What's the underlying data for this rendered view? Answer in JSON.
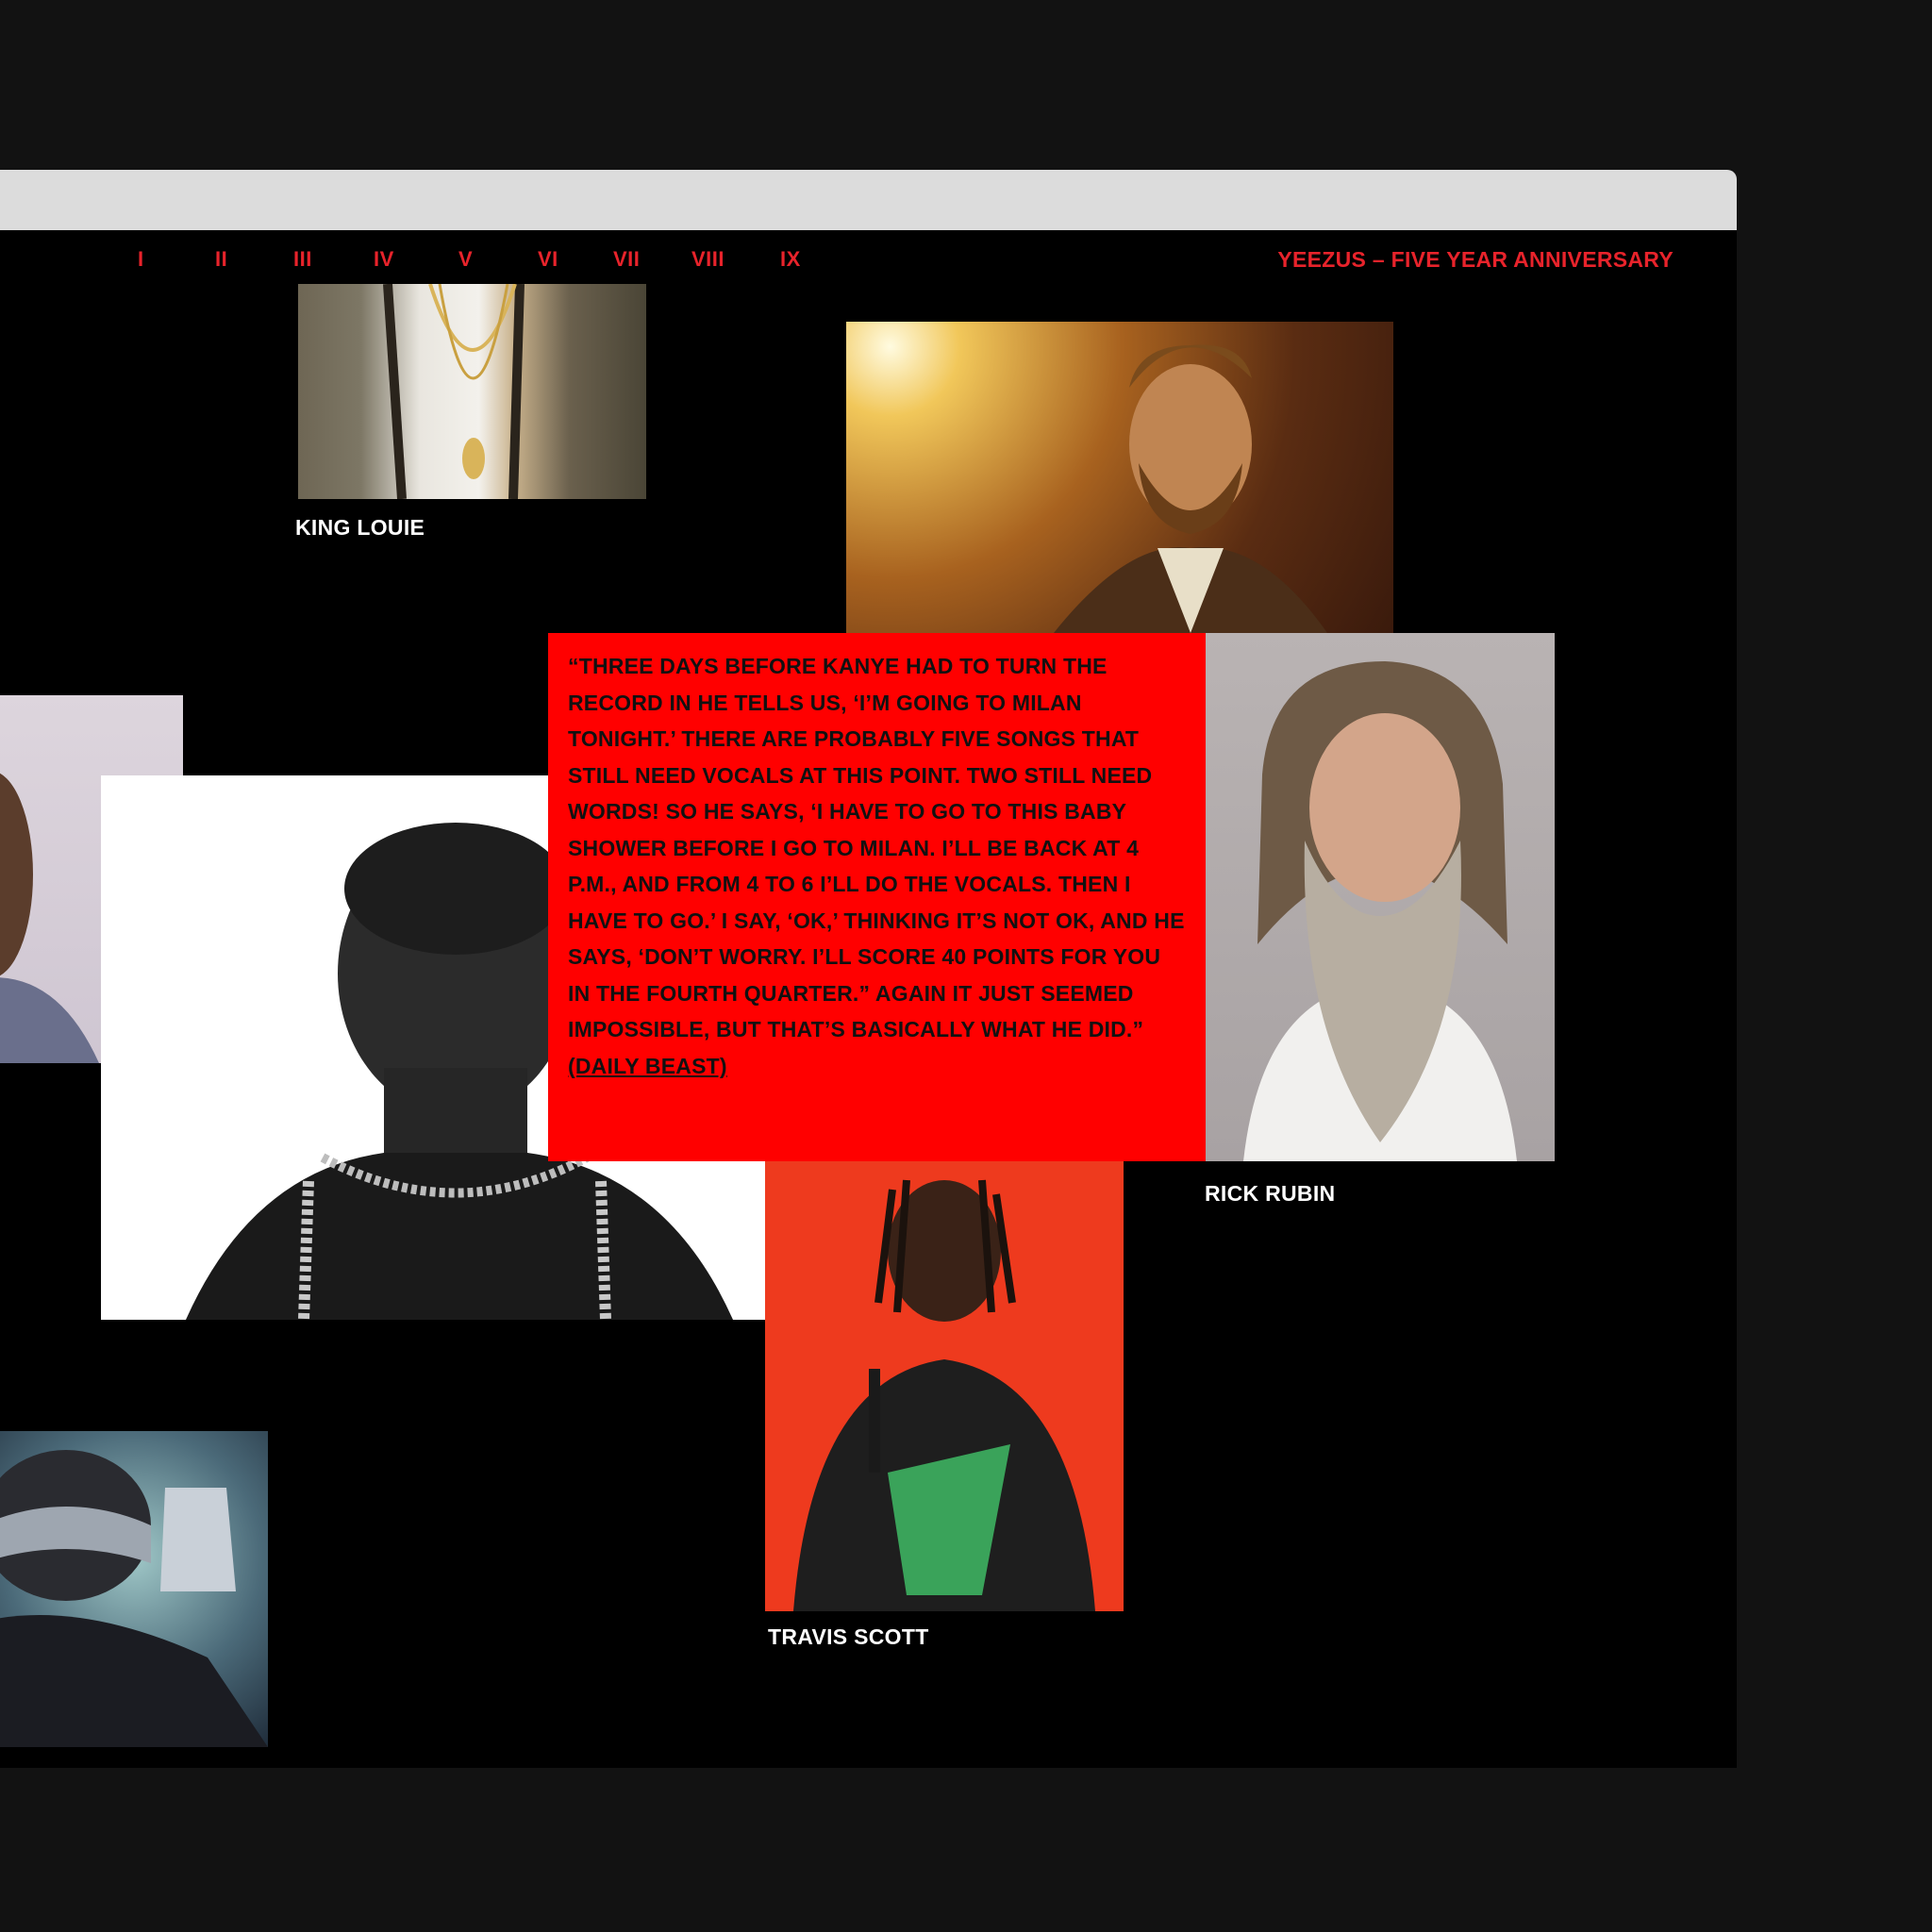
{
  "nav": {
    "items": [
      "I",
      "II",
      "III",
      "IV",
      "V",
      "VI",
      "VII",
      "VIII",
      "IX"
    ]
  },
  "site_title": "YEEZUS – FIVE YEAR ANNIVERSARY",
  "captions": {
    "king_louie": "KING LOUIE",
    "rick_rubin": "RICK RUBIN",
    "travis_scott": "TRAVIS SCOTT"
  },
  "quote": {
    "text": "“THREE DAYS BEFORE KANYE HAD TO TURN THE RECORD IN HE TELLS US, ‘I’M GOING TO MILAN TONIGHT.’ THERE ARE PROBABLY FIVE SONGS THAT STILL NEED VOCALS AT THIS POINT. TWO STILL NEED WORDS! SO HE SAYS, ‘I HAVE TO GO TO THIS BABY SHOWER BEFORE I GO TO MILAN. I’LL BE BACK AT 4 P.M., AND FROM 4 TO 6 I’LL DO THE VOCALS. THEN I HAVE TO GO.’ I SAY, ‘OK,’ THINKING IT’S NOT OK, AND HE SAYS, ‘DON’T WORRY. I’LL SCORE 40 POINTS FOR YOU IN THE FOURTH QUARTER.” AGAIN IT JUST SEEMED IMPOSSIBLE, BUT THAT’S BASICALLY WHAT HE DID.”",
    "source": "(DAILY BEAST)"
  },
  "colors": {
    "accent_red": "#e8232b",
    "quote_bg": "#ff0000",
    "page_bg": "#000000",
    "outer_bg": "#121212",
    "chrome": "#dcdcdc"
  }
}
